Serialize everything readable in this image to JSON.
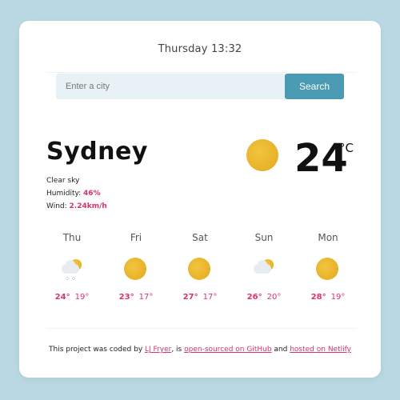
{
  "header": {
    "datetime": "Thursday 13:32"
  },
  "search": {
    "placeholder": "Enter a city",
    "value": "",
    "button_label": "Search"
  },
  "current": {
    "city": "Sydney",
    "description": "Clear sky",
    "humidity_label": "Humidity: ",
    "humidity_value": "46%",
    "wind_label": "Wind: ",
    "wind_value": "2.24km/h",
    "temperature": "24",
    "unit": "°C",
    "icon": "sun-icon"
  },
  "forecast": [
    {
      "day": "Thu",
      "max": "24°",
      "min": "19°",
      "icon": "rain-cloud-sun-icon"
    },
    {
      "day": "Fri",
      "max": "23°",
      "min": "17°",
      "icon": "sun-icon"
    },
    {
      "day": "Sat",
      "max": "27°",
      "min": "17°",
      "icon": "sun-icon"
    },
    {
      "day": "Sun",
      "max": "26°",
      "min": "20°",
      "icon": "cloud-sun-icon"
    },
    {
      "day": "Mon",
      "max": "28°",
      "min": "19°",
      "icon": "sun-icon"
    }
  ],
  "footer": {
    "text1": "This project was coded by ",
    "link1": "LJ Fryer",
    "text2": ", is ",
    "link2": "open-sourced on GitHub",
    "text3": " and ",
    "link3": "hosted on Netlify"
  },
  "colors": {
    "background": "#b9d8e2",
    "accent": "#d6336c",
    "button": "#4a9ab3",
    "sun": "#e8b52c"
  }
}
